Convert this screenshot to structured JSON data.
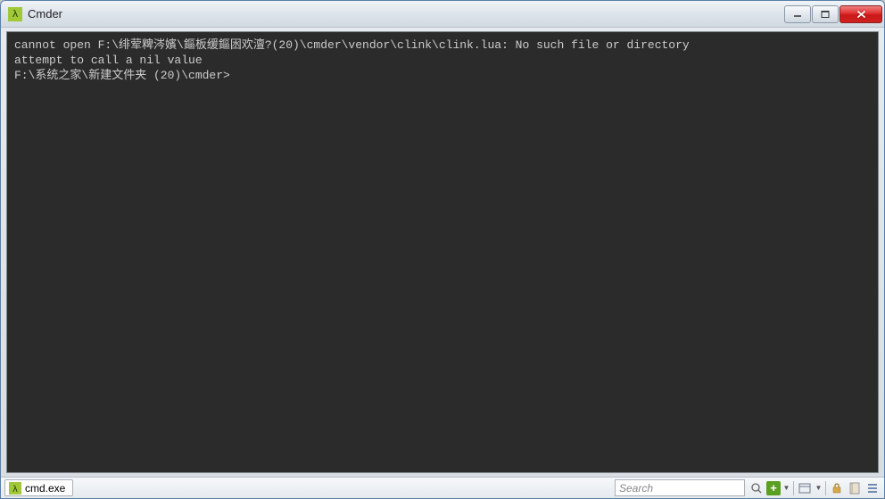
{
  "window": {
    "title": "Cmder",
    "icon_glyph": "λ"
  },
  "terminal": {
    "lines": [
      "cannot open F:\\绯荤粺涔嬪\\鏂板缓鏂囦欢澶?(20)\\cmder\\vendor\\clink\\clink.lua: No such file or directory",
      "attempt to call a nil value",
      "F:\\系统之家\\新建文件夹 (20)\\cmder>"
    ]
  },
  "statusbar": {
    "tab": {
      "label": "cmd.exe",
      "icon_glyph": "λ"
    },
    "search_placeholder": "Search"
  }
}
